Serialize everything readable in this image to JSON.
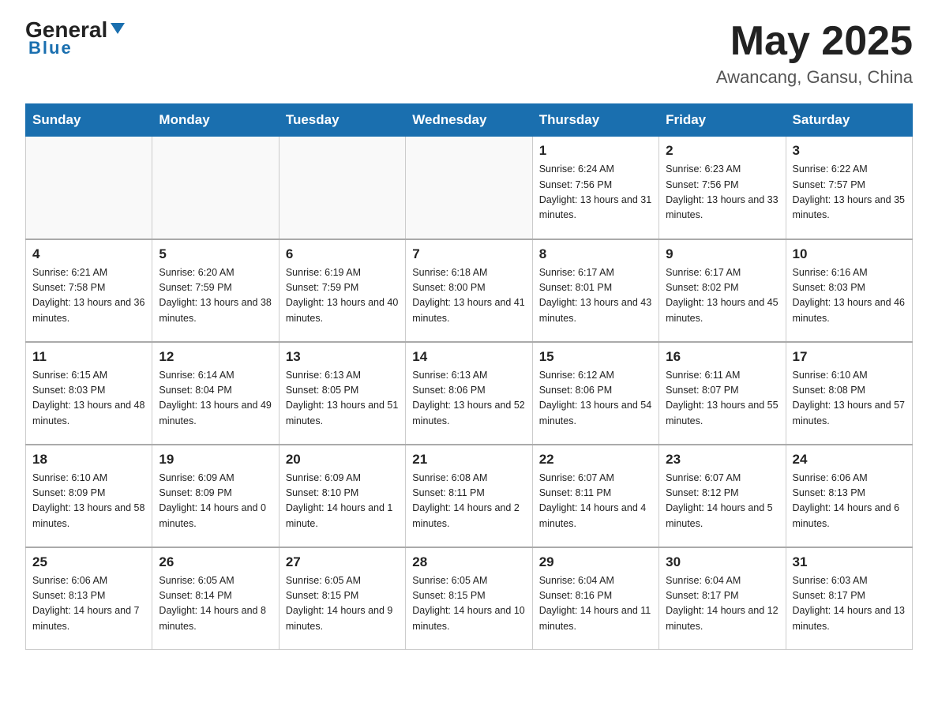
{
  "header": {
    "logo_general": "General",
    "logo_blue": "Blue",
    "month_title": "May 2025",
    "location": "Awancang, Gansu, China"
  },
  "weekdays": [
    "Sunday",
    "Monday",
    "Tuesday",
    "Wednesday",
    "Thursday",
    "Friday",
    "Saturday"
  ],
  "weeks": [
    [
      {
        "day": "",
        "sunrise": "",
        "sunset": "",
        "daylight": ""
      },
      {
        "day": "",
        "sunrise": "",
        "sunset": "",
        "daylight": ""
      },
      {
        "day": "",
        "sunrise": "",
        "sunset": "",
        "daylight": ""
      },
      {
        "day": "",
        "sunrise": "",
        "sunset": "",
        "daylight": ""
      },
      {
        "day": "1",
        "sunrise": "Sunrise: 6:24 AM",
        "sunset": "Sunset: 7:56 PM",
        "daylight": "Daylight: 13 hours and 31 minutes."
      },
      {
        "day": "2",
        "sunrise": "Sunrise: 6:23 AM",
        "sunset": "Sunset: 7:56 PM",
        "daylight": "Daylight: 13 hours and 33 minutes."
      },
      {
        "day": "3",
        "sunrise": "Sunrise: 6:22 AM",
        "sunset": "Sunset: 7:57 PM",
        "daylight": "Daylight: 13 hours and 35 minutes."
      }
    ],
    [
      {
        "day": "4",
        "sunrise": "Sunrise: 6:21 AM",
        "sunset": "Sunset: 7:58 PM",
        "daylight": "Daylight: 13 hours and 36 minutes."
      },
      {
        "day": "5",
        "sunrise": "Sunrise: 6:20 AM",
        "sunset": "Sunset: 7:59 PM",
        "daylight": "Daylight: 13 hours and 38 minutes."
      },
      {
        "day": "6",
        "sunrise": "Sunrise: 6:19 AM",
        "sunset": "Sunset: 7:59 PM",
        "daylight": "Daylight: 13 hours and 40 minutes."
      },
      {
        "day": "7",
        "sunrise": "Sunrise: 6:18 AM",
        "sunset": "Sunset: 8:00 PM",
        "daylight": "Daylight: 13 hours and 41 minutes."
      },
      {
        "day": "8",
        "sunrise": "Sunrise: 6:17 AM",
        "sunset": "Sunset: 8:01 PM",
        "daylight": "Daylight: 13 hours and 43 minutes."
      },
      {
        "day": "9",
        "sunrise": "Sunrise: 6:17 AM",
        "sunset": "Sunset: 8:02 PM",
        "daylight": "Daylight: 13 hours and 45 minutes."
      },
      {
        "day": "10",
        "sunrise": "Sunrise: 6:16 AM",
        "sunset": "Sunset: 8:03 PM",
        "daylight": "Daylight: 13 hours and 46 minutes."
      }
    ],
    [
      {
        "day": "11",
        "sunrise": "Sunrise: 6:15 AM",
        "sunset": "Sunset: 8:03 PM",
        "daylight": "Daylight: 13 hours and 48 minutes."
      },
      {
        "day": "12",
        "sunrise": "Sunrise: 6:14 AM",
        "sunset": "Sunset: 8:04 PM",
        "daylight": "Daylight: 13 hours and 49 minutes."
      },
      {
        "day": "13",
        "sunrise": "Sunrise: 6:13 AM",
        "sunset": "Sunset: 8:05 PM",
        "daylight": "Daylight: 13 hours and 51 minutes."
      },
      {
        "day": "14",
        "sunrise": "Sunrise: 6:13 AM",
        "sunset": "Sunset: 8:06 PM",
        "daylight": "Daylight: 13 hours and 52 minutes."
      },
      {
        "day": "15",
        "sunrise": "Sunrise: 6:12 AM",
        "sunset": "Sunset: 8:06 PM",
        "daylight": "Daylight: 13 hours and 54 minutes."
      },
      {
        "day": "16",
        "sunrise": "Sunrise: 6:11 AM",
        "sunset": "Sunset: 8:07 PM",
        "daylight": "Daylight: 13 hours and 55 minutes."
      },
      {
        "day": "17",
        "sunrise": "Sunrise: 6:10 AM",
        "sunset": "Sunset: 8:08 PM",
        "daylight": "Daylight: 13 hours and 57 minutes."
      }
    ],
    [
      {
        "day": "18",
        "sunrise": "Sunrise: 6:10 AM",
        "sunset": "Sunset: 8:09 PM",
        "daylight": "Daylight: 13 hours and 58 minutes."
      },
      {
        "day": "19",
        "sunrise": "Sunrise: 6:09 AM",
        "sunset": "Sunset: 8:09 PM",
        "daylight": "Daylight: 14 hours and 0 minutes."
      },
      {
        "day": "20",
        "sunrise": "Sunrise: 6:09 AM",
        "sunset": "Sunset: 8:10 PM",
        "daylight": "Daylight: 14 hours and 1 minute."
      },
      {
        "day": "21",
        "sunrise": "Sunrise: 6:08 AM",
        "sunset": "Sunset: 8:11 PM",
        "daylight": "Daylight: 14 hours and 2 minutes."
      },
      {
        "day": "22",
        "sunrise": "Sunrise: 6:07 AM",
        "sunset": "Sunset: 8:11 PM",
        "daylight": "Daylight: 14 hours and 4 minutes."
      },
      {
        "day": "23",
        "sunrise": "Sunrise: 6:07 AM",
        "sunset": "Sunset: 8:12 PM",
        "daylight": "Daylight: 14 hours and 5 minutes."
      },
      {
        "day": "24",
        "sunrise": "Sunrise: 6:06 AM",
        "sunset": "Sunset: 8:13 PM",
        "daylight": "Daylight: 14 hours and 6 minutes."
      }
    ],
    [
      {
        "day": "25",
        "sunrise": "Sunrise: 6:06 AM",
        "sunset": "Sunset: 8:13 PM",
        "daylight": "Daylight: 14 hours and 7 minutes."
      },
      {
        "day": "26",
        "sunrise": "Sunrise: 6:05 AM",
        "sunset": "Sunset: 8:14 PM",
        "daylight": "Daylight: 14 hours and 8 minutes."
      },
      {
        "day": "27",
        "sunrise": "Sunrise: 6:05 AM",
        "sunset": "Sunset: 8:15 PM",
        "daylight": "Daylight: 14 hours and 9 minutes."
      },
      {
        "day": "28",
        "sunrise": "Sunrise: 6:05 AM",
        "sunset": "Sunset: 8:15 PM",
        "daylight": "Daylight: 14 hours and 10 minutes."
      },
      {
        "day": "29",
        "sunrise": "Sunrise: 6:04 AM",
        "sunset": "Sunset: 8:16 PM",
        "daylight": "Daylight: 14 hours and 11 minutes."
      },
      {
        "day": "30",
        "sunrise": "Sunrise: 6:04 AM",
        "sunset": "Sunset: 8:17 PM",
        "daylight": "Daylight: 14 hours and 12 minutes."
      },
      {
        "day": "31",
        "sunrise": "Sunrise: 6:03 AM",
        "sunset": "Sunset: 8:17 PM",
        "daylight": "Daylight: 14 hours and 13 minutes."
      }
    ]
  ]
}
